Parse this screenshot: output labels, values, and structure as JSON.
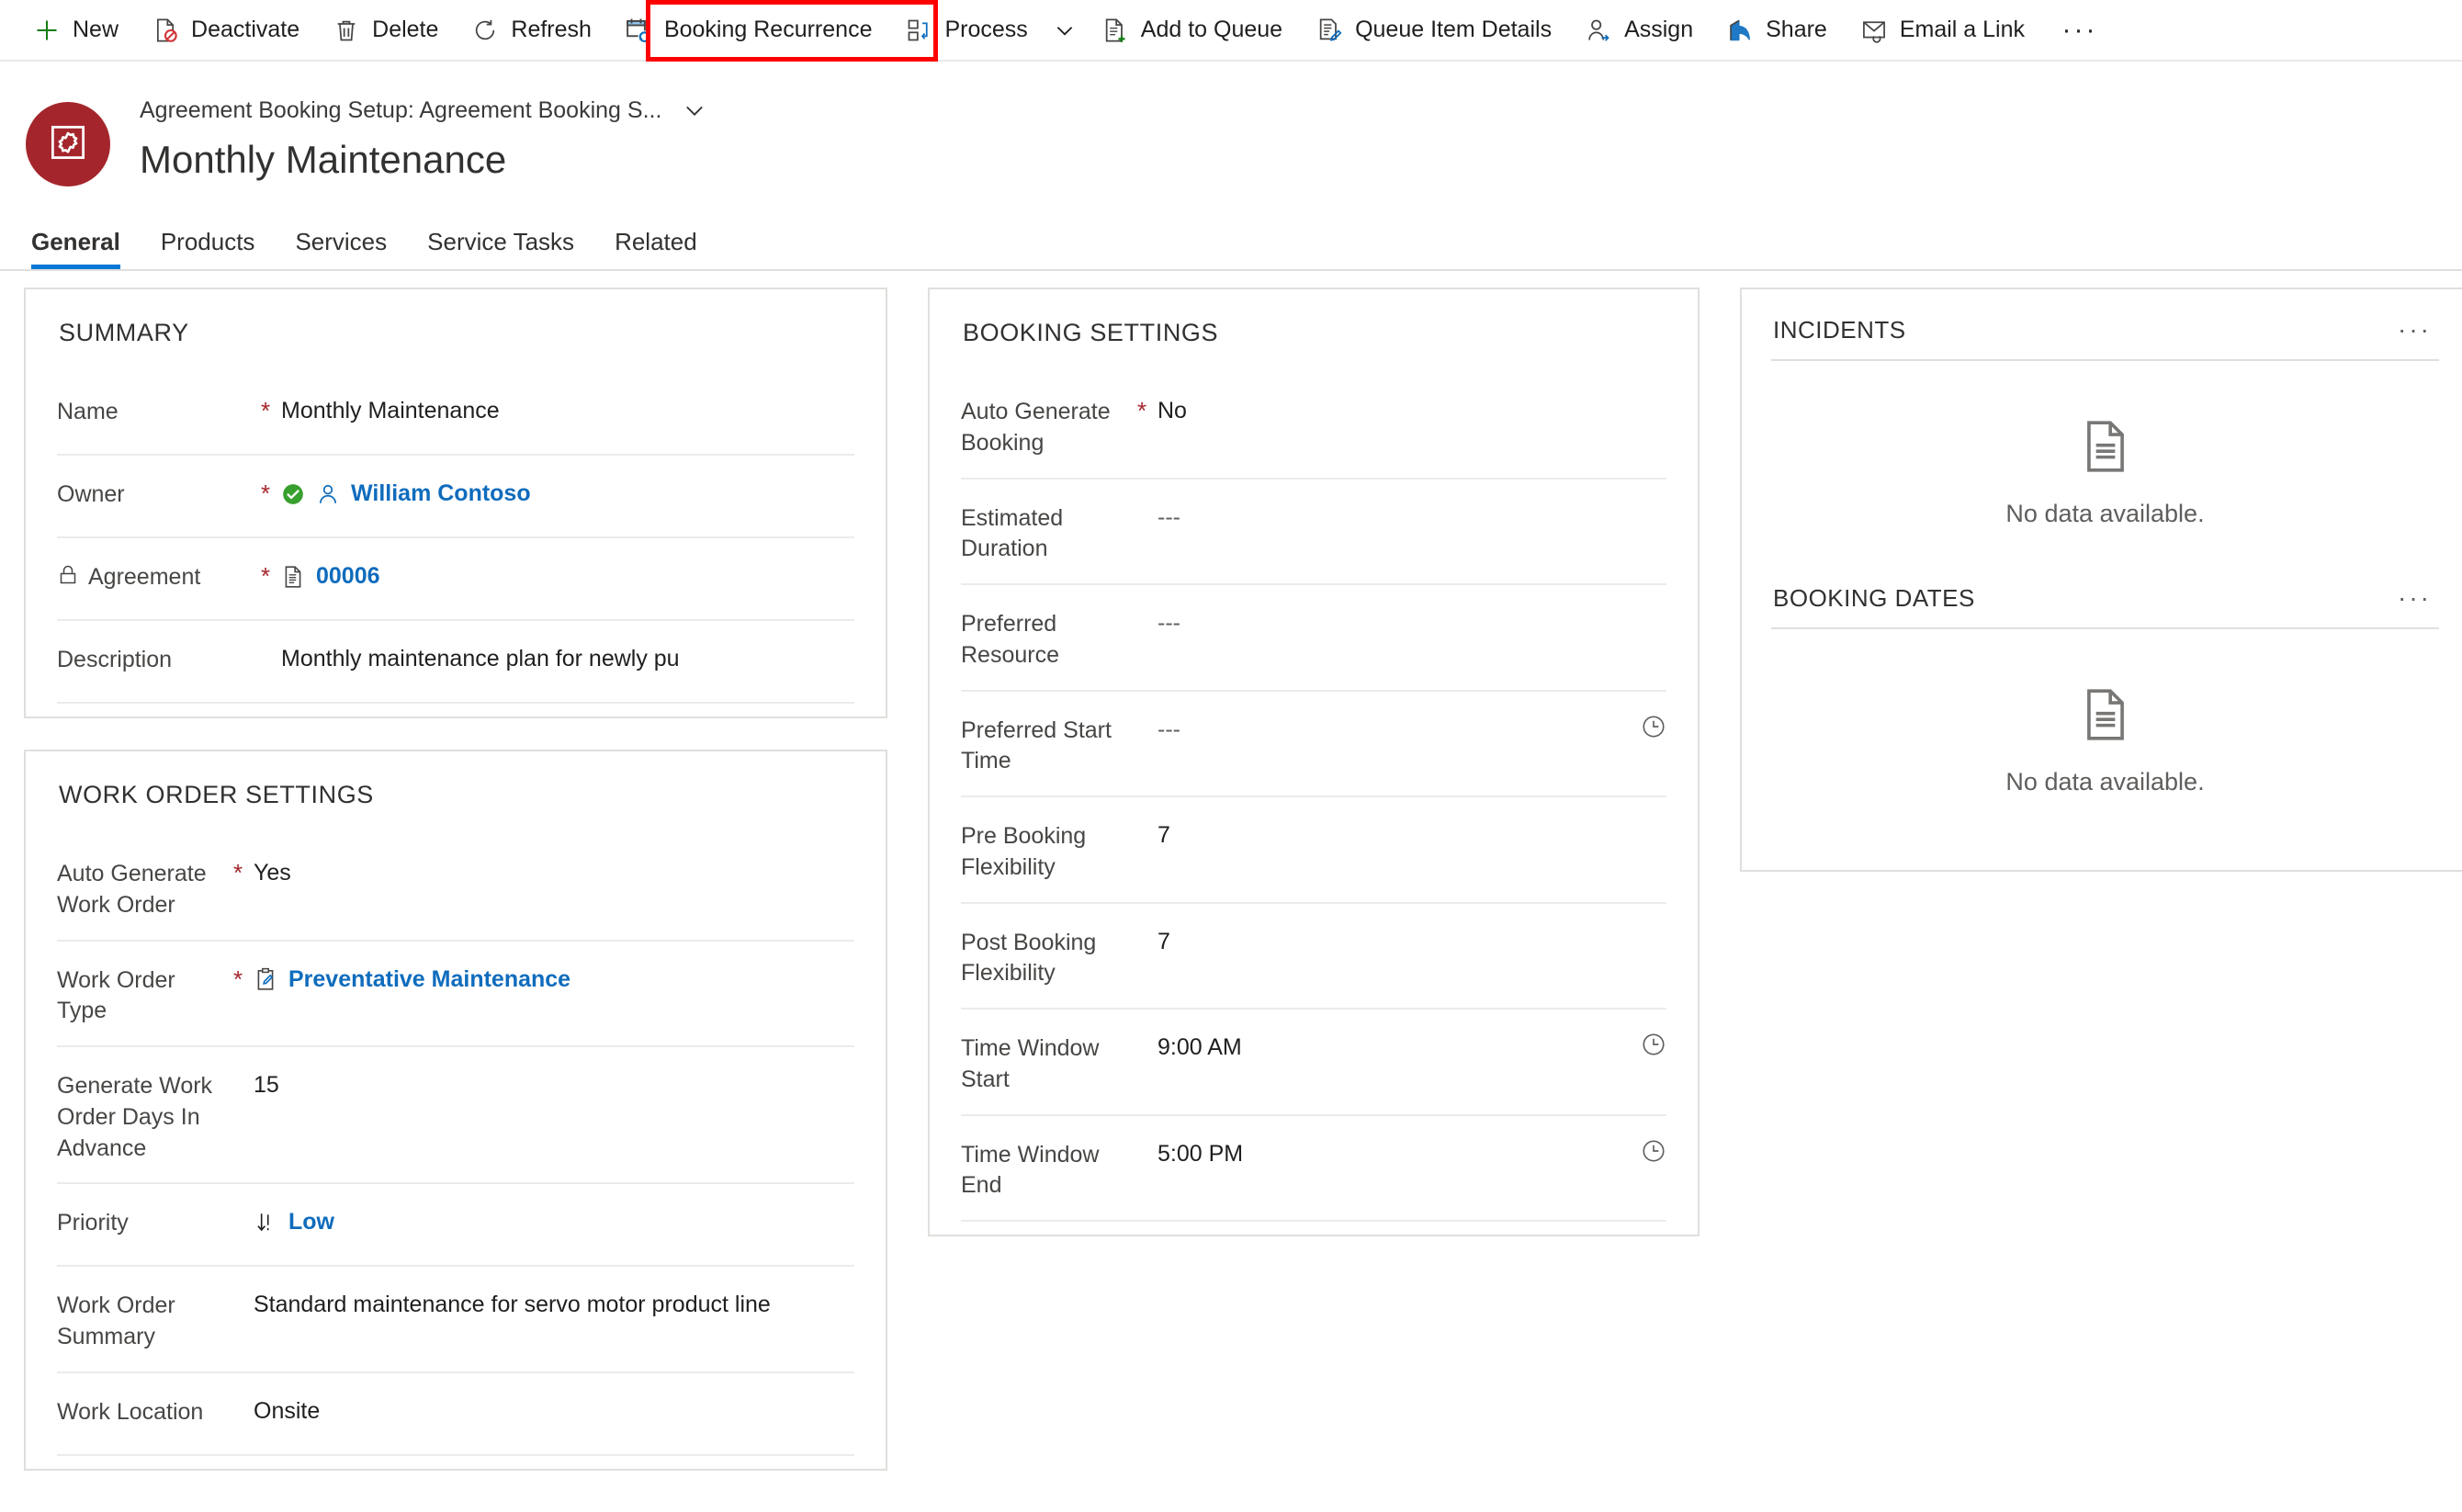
{
  "commandbar": {
    "items": [
      {
        "label": "New",
        "icon": "plus-icon"
      },
      {
        "label": "Deactivate",
        "icon": "deactivate-icon"
      },
      {
        "label": "Delete",
        "icon": "trash-icon"
      },
      {
        "label": "Refresh",
        "icon": "refresh-icon"
      },
      {
        "label": "Booking Recurrence",
        "icon": "booking-recurrence-icon"
      },
      {
        "label": "Process",
        "icon": "process-icon"
      },
      {
        "label": "Add to Queue",
        "icon": "add-to-queue-icon"
      },
      {
        "label": "Queue Item Details",
        "icon": "queue-item-details-icon"
      },
      {
        "label": "Assign",
        "icon": "assign-icon"
      },
      {
        "label": "Share",
        "icon": "share-icon"
      },
      {
        "label": "Email a Link",
        "icon": "email-link-icon"
      }
    ],
    "overflow_label": "···",
    "highlight_color": "#ff0000",
    "highlighted_item": "Booking Recurrence"
  },
  "record": {
    "breadcrumb": "Agreement Booking Setup: Agreement Booking S...",
    "title": "Monthly Maintenance",
    "avatar_color": "#a4262c",
    "avatar_icon": "gear-in-square-icon"
  },
  "tabs": [
    {
      "label": "General",
      "active": true
    },
    {
      "label": "Products",
      "active": false
    },
    {
      "label": "Services",
      "active": false
    },
    {
      "label": "Service Tasks",
      "active": false
    },
    {
      "label": "Related",
      "active": false
    }
  ],
  "summary": {
    "title": "SUMMARY",
    "fields": [
      {
        "label": "Name",
        "required": "*",
        "value": "Monthly Maintenance"
      },
      {
        "label": "Owner",
        "required": "*",
        "value": "William Contoso",
        "link": true,
        "icons": [
          "verified-check-icon",
          "person-icon"
        ]
      },
      {
        "label": "Agreement",
        "required": "*",
        "value": "00006",
        "link": true,
        "locked": true,
        "icons": [
          "document-icon"
        ]
      },
      {
        "label": "Description",
        "required": "",
        "value": "Monthly maintenance plan for newly pu"
      }
    ]
  },
  "work_order_settings": {
    "title": "WORK ORDER SETTINGS",
    "fields": [
      {
        "label": "Auto Generate Work Order",
        "required": "*",
        "value": "Yes"
      },
      {
        "label": "Work Order Type",
        "required": "*",
        "value": "Preventative Maintenance",
        "link": true,
        "icons": [
          "clipboard-pencil-icon"
        ]
      },
      {
        "label": "Generate Work Order Days In Advance",
        "required": "",
        "value": "15"
      },
      {
        "label": "Priority",
        "required": "",
        "value": "Low",
        "link": true,
        "icons": [
          "priority-low-icon"
        ]
      },
      {
        "label": "Work Order Summary",
        "required": "",
        "value": "Standard maintenance for servo motor product line"
      },
      {
        "label": "Work Location",
        "required": "",
        "value": "Onsite"
      }
    ]
  },
  "booking_settings": {
    "title": "BOOKING SETTINGS",
    "fields": [
      {
        "label": "Auto Generate Booking",
        "required": "*",
        "value": "No"
      },
      {
        "label": "Estimated Duration",
        "required": "",
        "value": "---",
        "muted": true
      },
      {
        "label": "Preferred Resource",
        "required": "",
        "value": "---",
        "muted": true
      },
      {
        "label": "Preferred Start Time",
        "required": "",
        "value": "---",
        "muted": true,
        "trailing_icon": "clock-icon"
      },
      {
        "label": "Pre Booking Flexibility",
        "required": "",
        "value": "7"
      },
      {
        "label": "Post Booking Flexibility",
        "required": "",
        "value": "7"
      },
      {
        "label": "Time Window Start",
        "required": "",
        "value": "9:00 AM",
        "trailing_icon": "clock-icon"
      },
      {
        "label": "Time Window End",
        "required": "",
        "value": "5:00 PM",
        "trailing_icon": "clock-icon"
      }
    ]
  },
  "right_panel": {
    "subgrids": [
      {
        "title": "INCIDENTS",
        "menu": "···",
        "empty_text": "No data available."
      },
      {
        "title": "BOOKING DATES",
        "menu": "···",
        "empty_text": "No data available."
      }
    ]
  }
}
